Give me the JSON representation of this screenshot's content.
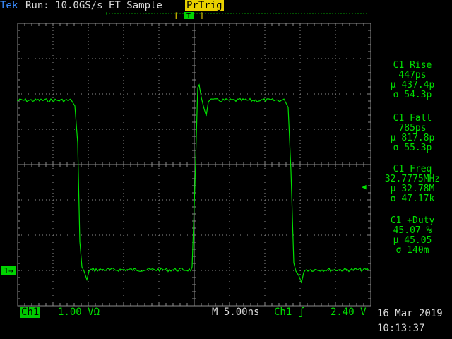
{
  "header": {
    "brand": "Tek",
    "run_status": "Run: 10.0GS/s ET Sample",
    "trigger_mode": "PrTrig",
    "trigger_position_marker": "T"
  },
  "channel_marker": {
    "label": "1→"
  },
  "measurements": [
    {
      "title": "C1 Rise",
      "value": "447ps",
      "mean": "µ 437.4p",
      "stdev": "σ 54.3p"
    },
    {
      "title": "C1 Fall",
      "value": "785ps",
      "mean": "µ 817.8p",
      "stdev": "σ 55.3p"
    },
    {
      "title": "C1 Freq",
      "value": "32.7775MHz",
      "mean": "µ 32.78M",
      "stdev": "σ 47.17k"
    },
    {
      "title": "C1 +Duty",
      "value": "45.07 %",
      "mean": "µ 45.05",
      "stdev": "σ 140m"
    }
  ],
  "footer": {
    "channel": "Ch1",
    "volts_per_div": "1.00 VΩ",
    "timebase": "M 5.00ns",
    "trigger_source": "Ch1",
    "trigger_slope": "ʃ",
    "trigger_level": "2.40 V",
    "date": "16 Mar 2019",
    "time": "10:13:37"
  },
  "colors": {
    "trace": "#00e000",
    "grid": "#8c8c8c",
    "brand": "#3a8cff",
    "trigger_badge": "#e8d000"
  }
}
